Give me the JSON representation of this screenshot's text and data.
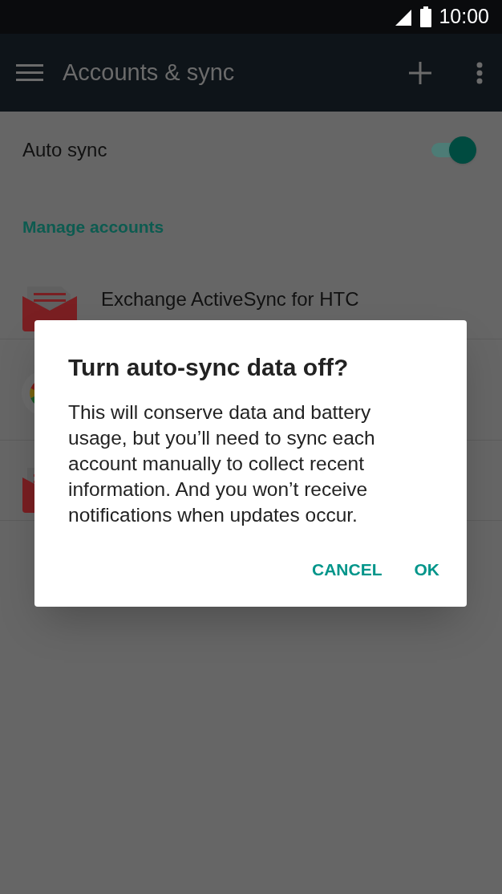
{
  "status_bar": {
    "time": "10:00"
  },
  "toolbar": {
    "title": "Accounts & sync"
  },
  "auto_sync": {
    "label": "Auto sync",
    "on": true
  },
  "section_header": "Manage accounts",
  "accounts": [
    {
      "kind": "mail",
      "title": "Exchange ActiveSync for HTC"
    },
    {
      "kind": "google"
    },
    {
      "kind": "mail"
    }
  ],
  "dialog": {
    "title": "Turn auto-sync data off?",
    "body": "This will conserve data and battery usage, but you’ll need to sync each account manually to collect recent information. And you won’t receive notifications when updates occur.",
    "buttons": [
      "CANCEL",
      "OK"
    ]
  }
}
